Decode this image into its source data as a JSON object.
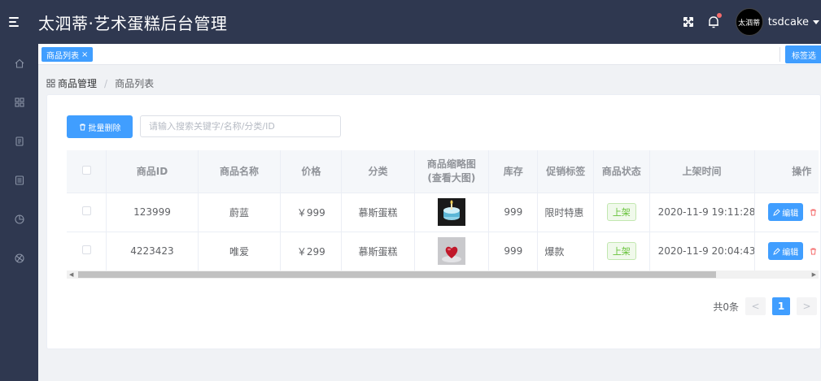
{
  "header": {
    "title": "太泗蒂·艺术蛋糕后台管理",
    "avatar_text": "太泗蒂",
    "username": "tsdcake"
  },
  "sidebar": {
    "items": [
      {
        "icon": "home-icon"
      },
      {
        "icon": "grid-icon"
      },
      {
        "icon": "document-icon"
      },
      {
        "icon": "list-icon"
      },
      {
        "icon": "pie-chart-icon"
      },
      {
        "icon": "globe-icon"
      }
    ]
  },
  "tags": {
    "active_tag": "商品列表",
    "close": "×",
    "options_label": "标签选"
  },
  "breadcrumb": {
    "root": "商品管理",
    "separator": "/",
    "current": "商品列表"
  },
  "toolbar": {
    "batch_delete_label": "批量删除",
    "search_placeholder": "请输入搜索关键字/名称/分类/ID"
  },
  "table": {
    "columns": [
      "商品ID",
      "商品名称",
      "价格",
      "分类",
      "商品缩略图\n(查看大图)",
      "库存",
      "促销标签",
      "商品状态",
      "上架时间",
      "操作"
    ],
    "col_line1": "商品缩略图",
    "col_line2": "(查看大图)",
    "rows": [
      {
        "id": "123999",
        "name": "蔚蓝",
        "price": "￥999",
        "category": "慕斯蛋糕",
        "stock": "999",
        "promo": "限时特惠",
        "status": "上架",
        "time": "2020-11-9 19:11:28"
      },
      {
        "id": "4223423",
        "name": "唯爱",
        "price": "￥299",
        "category": "慕斯蛋糕",
        "stock": "999",
        "promo": "爆款",
        "status": "上架",
        "time": "2020-11-9 20:04:43"
      }
    ],
    "edit_label": "编辑",
    "delete_label": "删除"
  },
  "pager": {
    "total_text": "共0条",
    "current_page": "1",
    "prev": "<",
    "next": ">"
  },
  "colors": {
    "header_bg": "#2f3850",
    "primary": "#409eff",
    "danger": "#f56c6c",
    "success": "#67c23a"
  }
}
